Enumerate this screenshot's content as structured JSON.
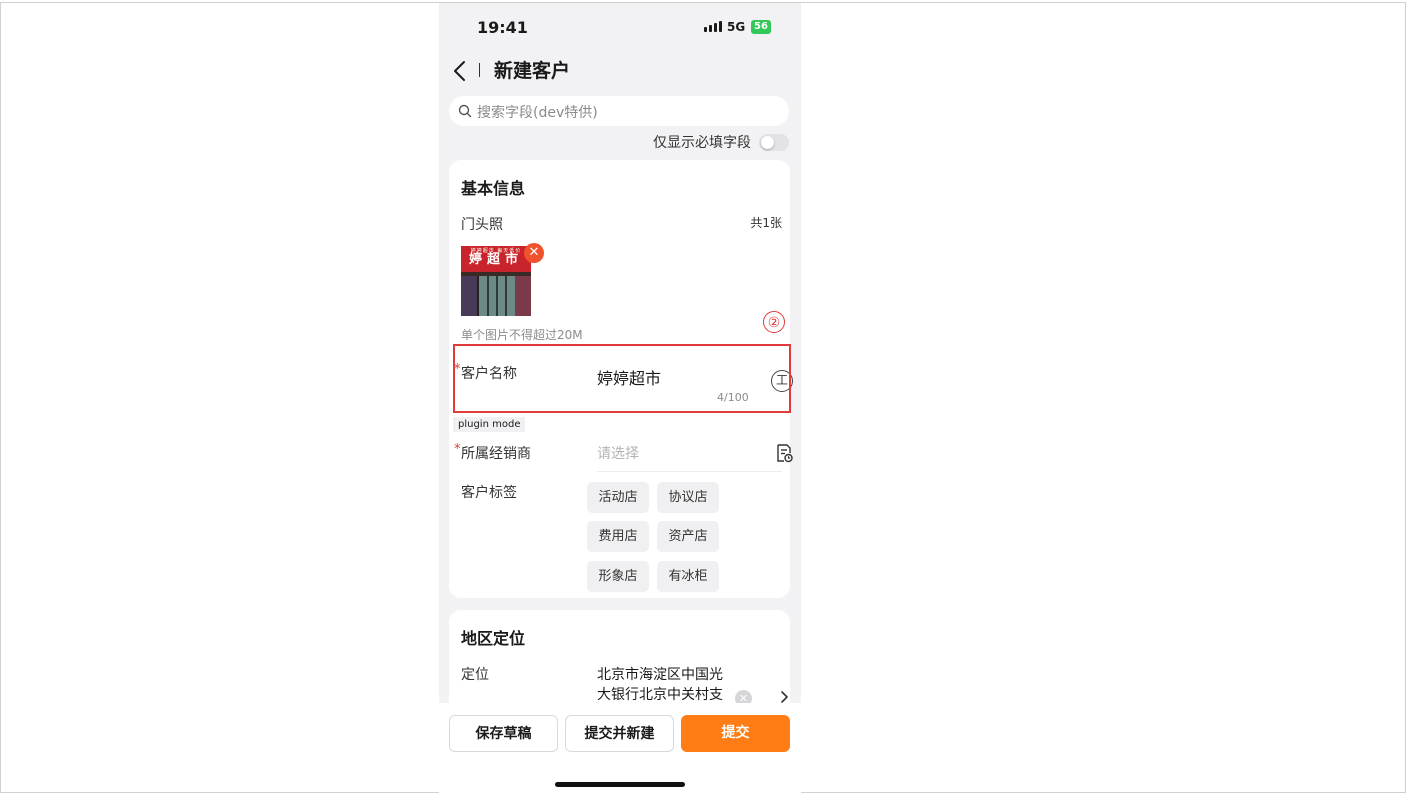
{
  "status": {
    "time": "19:41",
    "network": "5G",
    "battery": "56"
  },
  "nav": {
    "title": "新建客户"
  },
  "search": {
    "placeholder": "搜索字段(dev特供)"
  },
  "filter": {
    "label": "仅显示必填字段",
    "enabled": false
  },
  "basic": {
    "title": "基本信息",
    "photo_label": "门头照",
    "photo_count": "共1张",
    "photo_sign_small": "婷婷超市 每天低价",
    "photo_sign": "婷超市",
    "photo_hint": "单个图片不得超过20M",
    "annotation_number": "②",
    "name_label": "客户名称",
    "name_value": "婷婷超市",
    "name_count": "4/100",
    "ocr_glyph": "工",
    "plugin_badge": "plugin mode",
    "dealer_label": "所属经销商",
    "dealer_placeholder": "请选择",
    "tags_label": "客户标签",
    "tags": [
      "活动店",
      "协议店",
      "费用店",
      "资产店",
      "形象店",
      "有冰柜"
    ]
  },
  "region": {
    "title": "地区定位",
    "location_label": "定位",
    "location_line1": "北京市海淀区中国光",
    "location_line2": "大银行北京中关村支"
  },
  "actions": {
    "draft": "保存草稿",
    "submit_new": "提交并新建",
    "submit": "提交"
  },
  "colors": {
    "primary": "#ff7d14",
    "required": "#e63d2e",
    "highlight": "#e23b3b",
    "battery": "#34c759"
  }
}
